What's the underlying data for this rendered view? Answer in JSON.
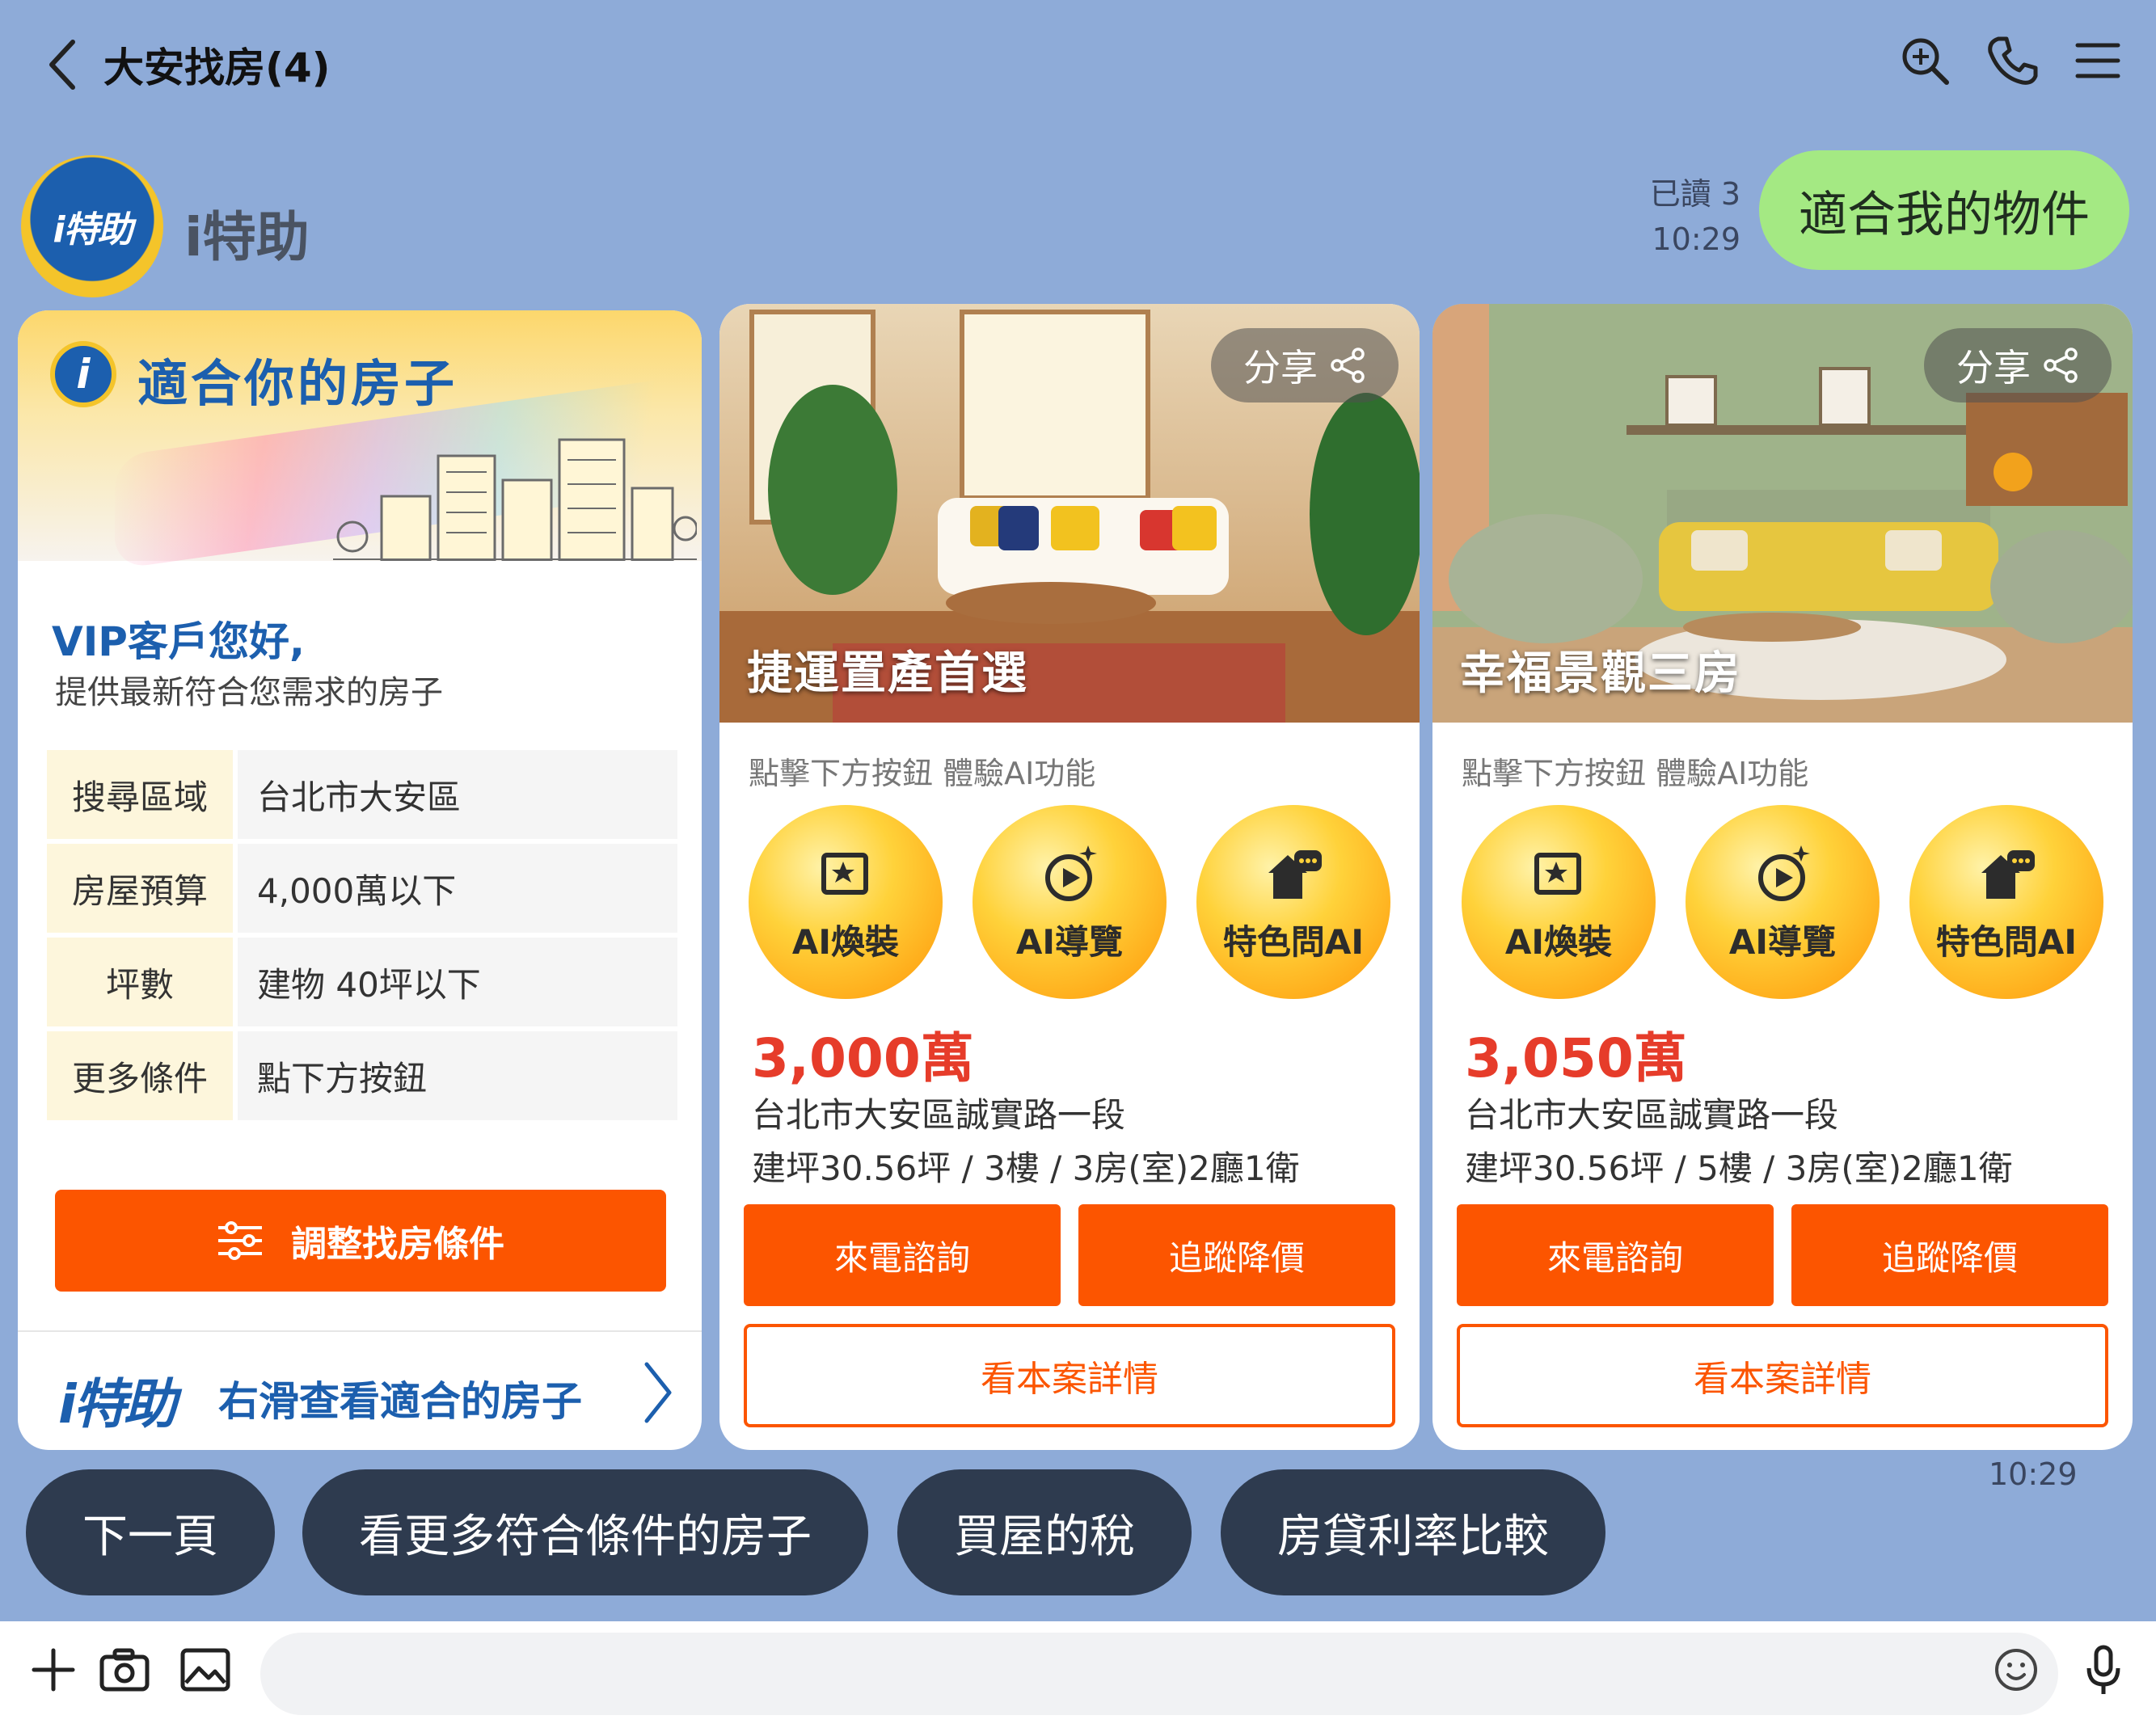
{
  "header": {
    "title": "大安找房(4)"
  },
  "bot": {
    "name": "i特助",
    "avatar_text": "i特助"
  },
  "user_message": {
    "text": "適合我的物件",
    "read": "已讀 3",
    "time": "10:29"
  },
  "intro_card": {
    "title": "適合你的房子",
    "greeting": "VIP客戶您好,",
    "subtitle": "提供最新符合您需求的房子",
    "conditions": [
      {
        "key": "搜尋區域",
        "value": "台北市大安區"
      },
      {
        "key": "房屋預算",
        "value": "4,000萬以下"
      },
      {
        "key": "坪數",
        "value": "建物 40坪以下"
      },
      {
        "key": "更多條件",
        "value": "點下方按鈕"
      }
    ],
    "adjust_button": "調整找房條件",
    "footer_logo": "i特助",
    "footer_text": "右滑查看適合的房子"
  },
  "listings": [
    {
      "image_title": "捷運置產首選",
      "share": "分享",
      "ai_hint": "點擊下方按鈕 體驗AI功能",
      "ai_buttons": [
        "AI煥裝",
        "AI導覽",
        "特色問AI"
      ],
      "price": "3,000萬",
      "address": "台北市大安區誠實路一段",
      "spec": "建坪30.56坪 / 3樓 / 3房(室)2廳1衛",
      "call_button": "來電諮詢",
      "track_button": "追蹤降價",
      "detail_button": "看本案詳情"
    },
    {
      "image_title": "幸福景觀三房",
      "share": "分享",
      "ai_hint": "點擊下方按鈕 體驗AI功能",
      "ai_buttons": [
        "AI煥裝",
        "AI導覽",
        "特色問AI"
      ],
      "price": "3,050萬",
      "address": "台北市大安區誠實路一段",
      "spec": "建坪30.56坪 / 5樓 / 3房(室)2廳1衛",
      "call_button": "來電諮詢",
      "track_button": "追蹤降價",
      "detail_button": "看本案詳情"
    }
  ],
  "bot_time": "10:29",
  "quick_replies": [
    "下一頁",
    "看更多符合條件的房子",
    "買屋的稅",
    "房貸利率比較"
  ],
  "colors": {
    "background": "#8eabd8",
    "accent": "#fc5500",
    "brand": "#1c5fae",
    "price": "#e63c2a",
    "user_bubble": "#a4e983"
  }
}
